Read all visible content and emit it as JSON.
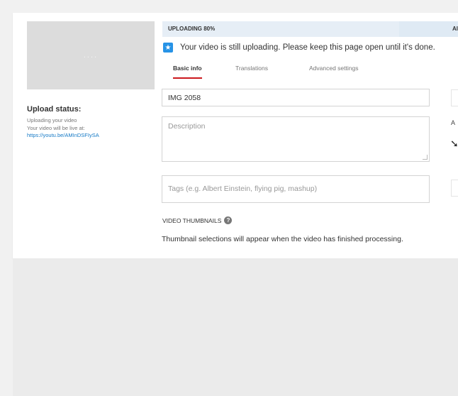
{
  "thumbnail": {
    "placeholder": "...."
  },
  "upload_status": {
    "title": "Upload status:",
    "state": "Uploading your video",
    "live_at_label": "Your video will be live at:",
    "link": "https://youtu.be/AMInDSFIySA"
  },
  "progress": {
    "label": "UPLOADING 80%",
    "percent": 80,
    "side_label": "Al"
  },
  "notice": {
    "icon": "star-icon",
    "text": "Your video is still uploading. Please keep this page open until it's done."
  },
  "tabs": [
    {
      "label": "Basic info",
      "active": true
    },
    {
      "label": "Translations",
      "active": false
    },
    {
      "label": "Advanced settings",
      "active": false
    }
  ],
  "form": {
    "title_value": "IMG 2058",
    "description_placeholder": "Description",
    "tags_placeholder": "Tags (e.g. Albert Einstein, flying pig, mashup)"
  },
  "thumbnails": {
    "label": "VIDEO THUMBNAILS",
    "help_icon": "question-icon",
    "message": "Thumbnail selections will appear when the video has finished processing."
  },
  "right_edge": {
    "letter": "A"
  },
  "colors": {
    "accent_red": "#cc181e",
    "link_blue": "#167ac6",
    "notice_blue": "#2793e6"
  }
}
